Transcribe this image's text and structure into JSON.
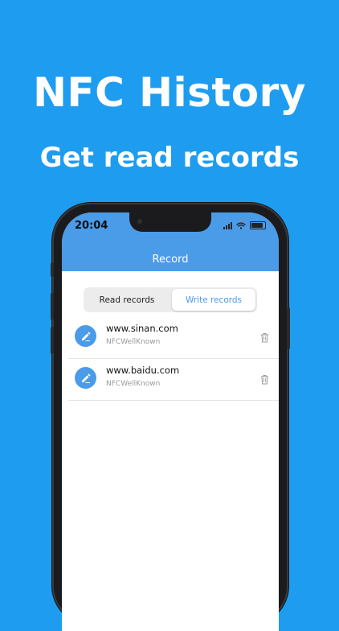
{
  "promo": {
    "title": "NFC History",
    "subtitle": "Get read records"
  },
  "status_bar": {
    "time": "20:04"
  },
  "nav": {
    "title": "Record"
  },
  "segments": [
    {
      "label": "Read records",
      "selected": false
    },
    {
      "label": "Write records",
      "selected": true
    }
  ],
  "records": [
    {
      "url": "www.sinan.com",
      "type": "NFCWellKnown",
      "icon": "edit-icon",
      "action_icon": "trash-icon"
    },
    {
      "url": "www.baidu.com",
      "type": "NFCWellKnown",
      "icon": "edit-icon",
      "action_icon": "trash-icon"
    }
  ],
  "colors": {
    "background": "#1e9df0",
    "accent": "#4a9be8",
    "subtle_text": "#9a9a9a"
  }
}
